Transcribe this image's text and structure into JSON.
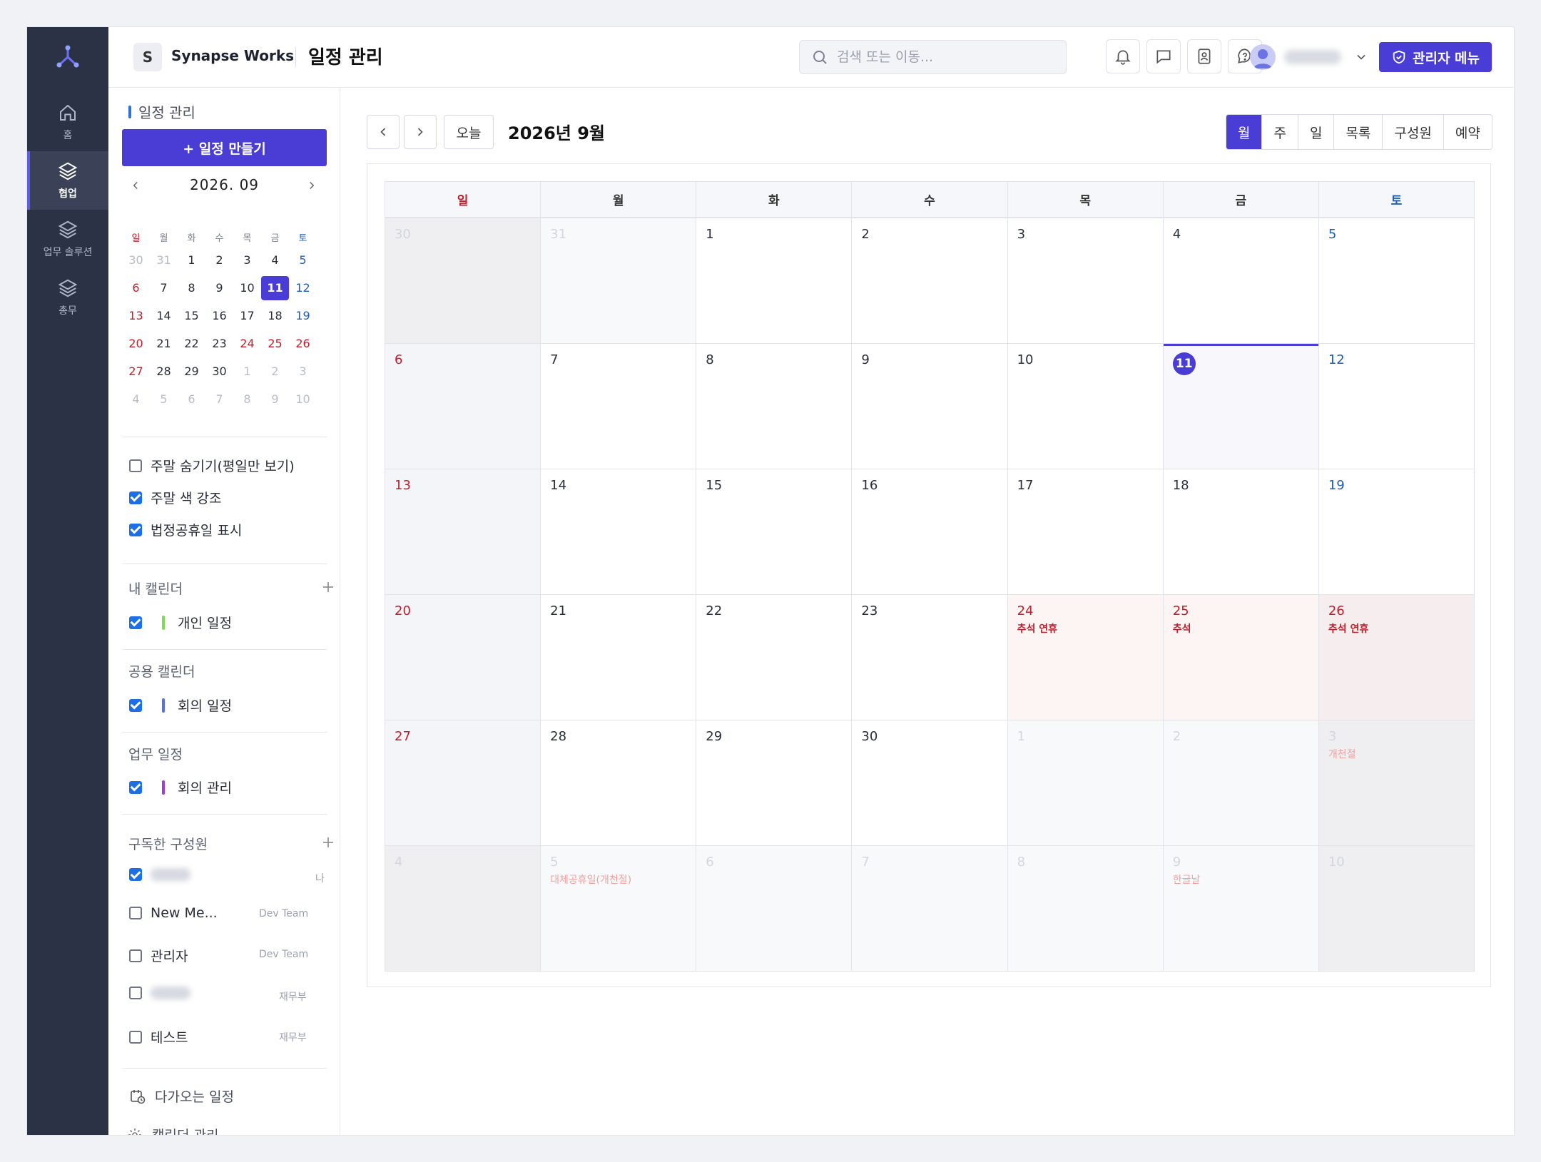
{
  "rail": {
    "items": [
      {
        "label": "홈",
        "icon": "home-icon"
      },
      {
        "label": "협업",
        "icon": "layers-icon",
        "active": true
      },
      {
        "label": "업무 솔루션",
        "icon": "layers-icon"
      },
      {
        "label": "총무",
        "icon": "layers-icon"
      }
    ]
  },
  "header": {
    "workspace_badge": "S",
    "workspace_name": "Synapse Works",
    "page_title": "일정 관리",
    "search_placeholder": "검색 또는 이동...",
    "admin_label": "관리자 메뉴"
  },
  "sidebar": {
    "section_title": "일정 관리",
    "create_label": "+ 일정 만들기",
    "mini": {
      "title": "2026. 09",
      "dow": [
        "일",
        "월",
        "화",
        "수",
        "목",
        "금",
        "토"
      ],
      "weeks": [
        [
          "30",
          "31",
          "1",
          "2",
          "3",
          "4",
          "5"
        ],
        [
          "6",
          "7",
          "8",
          "9",
          "10",
          "11",
          "12"
        ],
        [
          "13",
          "14",
          "15",
          "16",
          "17",
          "18",
          "19"
        ],
        [
          "20",
          "21",
          "22",
          "23",
          "24",
          "25",
          "26"
        ],
        [
          "27",
          "28",
          "29",
          "30",
          "1",
          "2",
          "3"
        ],
        [
          "4",
          "5",
          "6",
          "7",
          "8",
          "9",
          "10"
        ]
      ]
    },
    "options": [
      {
        "label": "주말 숨기기(평일만 보기)",
        "checked": false
      },
      {
        "label": "주말 색 강조",
        "checked": true
      },
      {
        "label": "법정공휴일 표시",
        "checked": true
      }
    ],
    "my_calendars": {
      "title": "내 캘린더",
      "items": [
        {
          "label": "개인 일정",
          "color": "#7ed957"
        }
      ]
    },
    "shared_calendars": {
      "title": "공용 캘린더",
      "items": [
        {
          "label": "회의 일정",
          "color": "#5b6ee1"
        }
      ]
    },
    "work_calendars": {
      "title": "업무 일정",
      "items": [
        {
          "label": "회의 관리",
          "color": "#9b3fd6"
        }
      ]
    },
    "subscribed": {
      "title": "구독한 구성원",
      "me_tag": "나",
      "members": [
        {
          "name": "",
          "dept": "",
          "checked": true
        },
        {
          "name": "New Me...",
          "dept": "Dev Team",
          "checked": false
        },
        {
          "name": "관리자",
          "dept": "Dev Team",
          "checked": false
        },
        {
          "name": "",
          "dept": "재무부",
          "checked": false
        },
        {
          "name": "테스트",
          "dept": "재무부",
          "checked": false
        }
      ]
    },
    "upcoming_label": "다가오는 일정",
    "manage_label": "캘린더 관리"
  },
  "toolbar": {
    "today_label": "오늘",
    "month_title": "2026년 9월",
    "views": [
      "월",
      "주",
      "일",
      "목록",
      "구성원",
      "예약"
    ],
    "active_view": "월"
  },
  "calendar": {
    "dow": [
      "일",
      "월",
      "화",
      "수",
      "목",
      "금",
      "토"
    ],
    "weeks": [
      [
        {
          "d": "30",
          "o": 1
        },
        {
          "d": "31",
          "o": 1
        },
        {
          "d": "1"
        },
        {
          "d": "2"
        },
        {
          "d": "3"
        },
        {
          "d": "4"
        },
        {
          "d": "5"
        }
      ],
      [
        {
          "d": "6"
        },
        {
          "d": "7"
        },
        {
          "d": "8"
        },
        {
          "d": "9"
        },
        {
          "d": "10"
        },
        {
          "d": "11",
          "today": 1
        },
        {
          "d": "12"
        }
      ],
      [
        {
          "d": "13"
        },
        {
          "d": "14"
        },
        {
          "d": "15"
        },
        {
          "d": "16"
        },
        {
          "d": "17"
        },
        {
          "d": "18"
        },
        {
          "d": "19"
        }
      ],
      [
        {
          "d": "20"
        },
        {
          "d": "21"
        },
        {
          "d": "22"
        },
        {
          "d": "23"
        },
        {
          "d": "24",
          "hol": 1,
          "ev": "추석 연휴"
        },
        {
          "d": "25",
          "hol": 1,
          "ev": "추석"
        },
        {
          "d": "26",
          "hol": 1,
          "ev": "추석 연휴"
        }
      ],
      [
        {
          "d": "27"
        },
        {
          "d": "28"
        },
        {
          "d": "29"
        },
        {
          "d": "30"
        },
        {
          "d": "1",
          "o": 1
        },
        {
          "d": "2",
          "o": 1
        },
        {
          "d": "3",
          "o": 1,
          "ev": "개천절"
        }
      ],
      [
        {
          "d": "4",
          "o": 1
        },
        {
          "d": "5",
          "o": 1,
          "ev": "대체공휴일(개천절)"
        },
        {
          "d": "6",
          "o": 1
        },
        {
          "d": "7",
          "o": 1
        },
        {
          "d": "8",
          "o": 1
        },
        {
          "d": "9",
          "o": 1,
          "ev": "한글날"
        },
        {
          "d": "10",
          "o": 1
        }
      ]
    ]
  },
  "colors": {
    "accent": "#4a3dd6",
    "sunday": "#c01e2b",
    "saturday": "#1f5fb3",
    "rail": "#2b3245"
  }
}
